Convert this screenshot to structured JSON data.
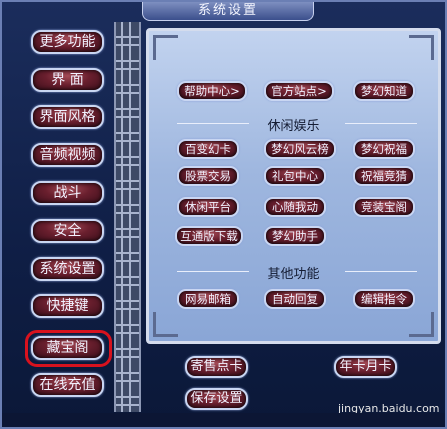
{
  "window": {
    "title": "系统设置"
  },
  "sidebar": {
    "items": [
      {
        "label": "更多功能"
      },
      {
        "label": "界  面"
      },
      {
        "label": "界面风格"
      },
      {
        "label": "音频视频"
      },
      {
        "label": "战斗"
      },
      {
        "label": "安全"
      },
      {
        "label": "系统设置"
      },
      {
        "label": "快捷键"
      },
      {
        "label": "藏宝阁"
      },
      {
        "label": "在线充值"
      }
    ]
  },
  "panel": {
    "top_links": [
      {
        "label": "帮助中心>"
      },
      {
        "label": "官方站点>"
      },
      {
        "label": "梦幻知道"
      }
    ],
    "leisure": {
      "title": "休闲娱乐",
      "buttons": [
        {
          "label": "百变幻卡"
        },
        {
          "label": "梦幻风云榜"
        },
        {
          "label": "梦幻祝福"
        },
        {
          "label": "股票交易"
        },
        {
          "label": "礼包中心"
        },
        {
          "label": "祝福竞猜"
        },
        {
          "label": "休闲平台"
        },
        {
          "label": "心随我动"
        },
        {
          "label": "竞装宝阁"
        },
        {
          "label": "互通版下载"
        },
        {
          "label": "梦幻助手"
        }
      ]
    },
    "other": {
      "title": "其他功能",
      "buttons": [
        {
          "label": "网易邮箱"
        },
        {
          "label": "自动回复"
        },
        {
          "label": "编辑指令"
        }
      ]
    }
  },
  "bottom": {
    "buttons": [
      {
        "label": "寄售点卡"
      },
      {
        "label": "年卡月卡"
      },
      {
        "label": "保存设置"
      }
    ]
  },
  "watermark": {
    "text": "jingyan.baidu.com"
  },
  "colors": {
    "highlight_ring": "#d8121e",
    "panel_bg": "#a9bfe4",
    "button_bg": "#6a1f2e"
  }
}
